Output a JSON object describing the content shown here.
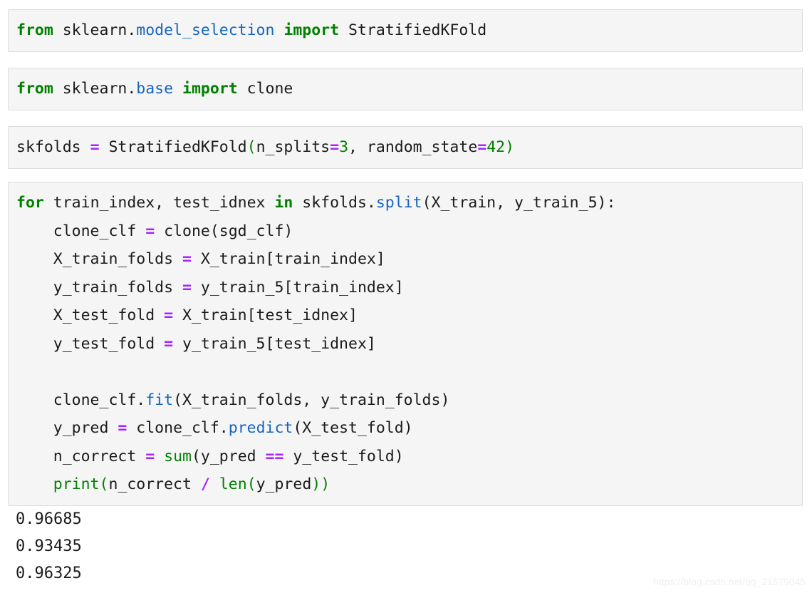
{
  "notebook": {
    "cells": [
      {
        "id": "cell-import-stratifiedkfold",
        "lines": [
          [
            {
              "t": "from",
              "c": "kw"
            },
            {
              "t": " sklearn.",
              "c": "plain"
            },
            {
              "t": "model_selection",
              "c": "mod"
            },
            {
              "t": " ",
              "c": "plain"
            },
            {
              "t": "import",
              "c": "kw"
            },
            {
              "t": " StratifiedKFold",
              "c": "plain"
            }
          ]
        ]
      },
      {
        "id": "cell-import-clone",
        "lines": [
          [
            {
              "t": "from",
              "c": "kw"
            },
            {
              "t": " sklearn.",
              "c": "plain"
            },
            {
              "t": "base",
              "c": "mod"
            },
            {
              "t": " ",
              "c": "plain"
            },
            {
              "t": "import",
              "c": "kw"
            },
            {
              "t": " clone",
              "c": "plain"
            }
          ]
        ]
      },
      {
        "id": "cell-skfolds-definition",
        "lines": [
          [
            {
              "t": "skfolds ",
              "c": "plain"
            },
            {
              "t": "=",
              "c": "op"
            },
            {
              "t": " StratifiedKFold",
              "c": "plain"
            },
            {
              "t": "(",
              "c": "paren-g"
            },
            {
              "t": "n_splits",
              "c": "plain"
            },
            {
              "t": "=",
              "c": "op"
            },
            {
              "t": "3",
              "c": "num"
            },
            {
              "t": ", random_state",
              "c": "plain"
            },
            {
              "t": "=",
              "c": "op"
            },
            {
              "t": "42",
              "c": "num"
            },
            {
              "t": ")",
              "c": "paren-g"
            }
          ]
        ]
      },
      {
        "id": "cell-cross-validation-loop",
        "lines": [
          [
            {
              "t": "for",
              "c": "kw"
            },
            {
              "t": " train_index, test_idnex ",
              "c": "plain"
            },
            {
              "t": "in",
              "c": "kw"
            },
            {
              "t": " skfolds.",
              "c": "plain"
            },
            {
              "t": "split",
              "c": "fn"
            },
            {
              "t": "(X_train, y_train_5):",
              "c": "plain"
            }
          ],
          [
            {
              "t": "    clone_clf ",
              "c": "plain"
            },
            {
              "t": "=",
              "c": "op"
            },
            {
              "t": " clone(sgd_clf)",
              "c": "plain"
            }
          ],
          [
            {
              "t": "    X_train_folds ",
              "c": "plain"
            },
            {
              "t": "=",
              "c": "op"
            },
            {
              "t": " X_train[train_index]",
              "c": "plain"
            }
          ],
          [
            {
              "t": "    y_train_folds ",
              "c": "plain"
            },
            {
              "t": "=",
              "c": "op"
            },
            {
              "t": " y_train_5[train_index]",
              "c": "plain"
            }
          ],
          [
            {
              "t": "    X_test_fold ",
              "c": "plain"
            },
            {
              "t": "=",
              "c": "op"
            },
            {
              "t": " X_train[test_idnex]",
              "c": "plain"
            }
          ],
          [
            {
              "t": "    y_test_fold ",
              "c": "plain"
            },
            {
              "t": "=",
              "c": "op"
            },
            {
              "t": " y_train_5[test_idnex]",
              "c": "plain"
            }
          ],
          [],
          [
            {
              "t": "    clone_clf.",
              "c": "plain"
            },
            {
              "t": "fit",
              "c": "fn"
            },
            {
              "t": "(X_train_folds, y_train_folds)",
              "c": "plain"
            }
          ],
          [
            {
              "t": "    y_pred ",
              "c": "plain"
            },
            {
              "t": "=",
              "c": "op"
            },
            {
              "t": " clone_clf.",
              "c": "plain"
            },
            {
              "t": "predict",
              "c": "fn"
            },
            {
              "t": "(X_test_fold)",
              "c": "plain"
            }
          ],
          [
            {
              "t": "    n_correct ",
              "c": "plain"
            },
            {
              "t": "=",
              "c": "op"
            },
            {
              "t": " ",
              "c": "plain"
            },
            {
              "t": "sum",
              "c": "builtin"
            },
            {
              "t": "(y_pred ",
              "c": "plain"
            },
            {
              "t": "==",
              "c": "op"
            },
            {
              "t": " y_test_fold)",
              "c": "plain"
            }
          ],
          [
            {
              "t": "    ",
              "c": "plain"
            },
            {
              "t": "print(",
              "c": "builtin"
            },
            {
              "t": "n_correct ",
              "c": "plain"
            },
            {
              "t": "/",
              "c": "op"
            },
            {
              "t": " ",
              "c": "plain"
            },
            {
              "t": "len(",
              "c": "builtin"
            },
            {
              "t": "y_pred",
              "c": "plain"
            },
            {
              "t": "))",
              "c": "builtin"
            }
          ]
        ]
      }
    ],
    "output": {
      "lines": [
        "0.96685",
        "0.93435",
        "0.96325"
      ]
    },
    "watermark": "https://blog.csdn.net/qq_21579045"
  }
}
